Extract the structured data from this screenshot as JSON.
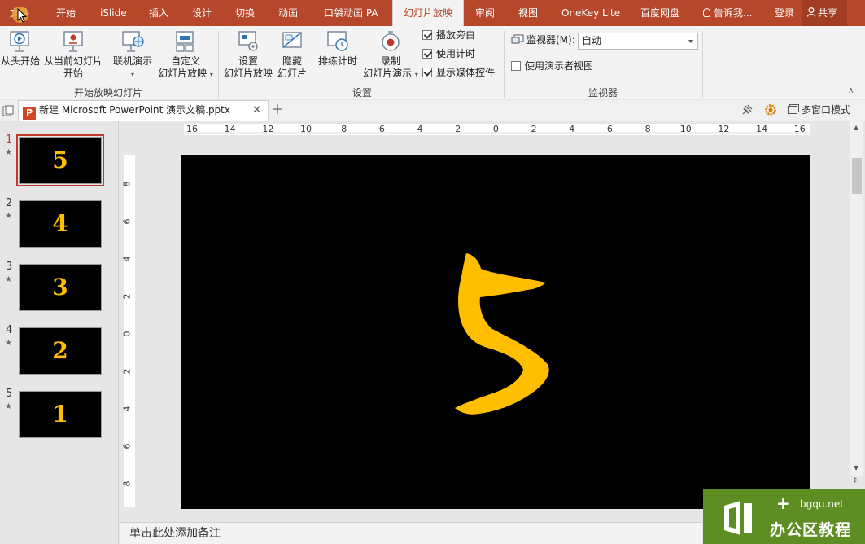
{
  "menubar": {
    "tabs": [
      {
        "label": "文件"
      },
      {
        "label": "开始"
      },
      {
        "label": "iSlide"
      },
      {
        "label": "插入"
      },
      {
        "label": "设计"
      },
      {
        "label": "切换"
      },
      {
        "label": "动画"
      },
      {
        "label": "口袋动画 PA"
      },
      {
        "label": "幻灯片放映"
      },
      {
        "label": "审阅"
      },
      {
        "label": "视图"
      },
      {
        "label": "OneKey Lite"
      },
      {
        "label": "百度网盘"
      }
    ],
    "tell_me": "告诉我...",
    "login": "登录",
    "share": "共享"
  },
  "ribbon": {
    "start_group": {
      "from_beginning": "从头开始",
      "from_current_line1": "从当前幻灯片",
      "from_current_line2": "开始",
      "online_present": "联机演示",
      "custom_line1": "自定义",
      "custom_line2": "幻灯片放映",
      "label": "开始放映幻灯片"
    },
    "setup_group": {
      "setup_line1": "设置",
      "setup_line2": "幻灯片放映",
      "hide_line1": "隐藏",
      "hide_line2": "幻灯片",
      "rehearse": "排练计时",
      "record_line1": "录制",
      "record_line2": "幻灯片演示",
      "play_narration": "播放旁白",
      "use_timings": "使用计时",
      "show_media_controls": "显示媒体控件",
      "label": "设置"
    },
    "monitor_group": {
      "monitor_label": "监视器(M):",
      "monitor_value": "自动",
      "presenter_view": "使用演示者视图",
      "label": "监视器"
    }
  },
  "document": {
    "tab_title": "新建 Microsoft PowerPoint 演示文稿.pptx",
    "multi_window": "多窗口模式"
  },
  "slides": [
    {
      "number": "1",
      "digit": "5",
      "active": true
    },
    {
      "number": "2",
      "digit": "4",
      "active": false
    },
    {
      "number": "3",
      "digit": "3",
      "active": false
    },
    {
      "number": "4",
      "digit": "2",
      "active": false
    },
    {
      "number": "5",
      "digit": "1",
      "active": false
    }
  ],
  "rulers": {
    "horizontal": [
      "16",
      "14",
      "12",
      "10",
      "8",
      "6",
      "4",
      "2",
      "0",
      "2",
      "4",
      "6",
      "8",
      "10",
      "12",
      "14",
      "16"
    ],
    "vertical": [
      "8",
      "6",
      "4",
      "2",
      "0",
      "2",
      "4",
      "6",
      "8"
    ]
  },
  "notes_placeholder": "单击此处添加备注",
  "watermark": {
    "site": "bgqu.net",
    "name": "办公区教程"
  },
  "colors": {
    "accent": "#b7472a",
    "digit": "#ffbe00",
    "watermark_bg": "#5d8d23"
  }
}
